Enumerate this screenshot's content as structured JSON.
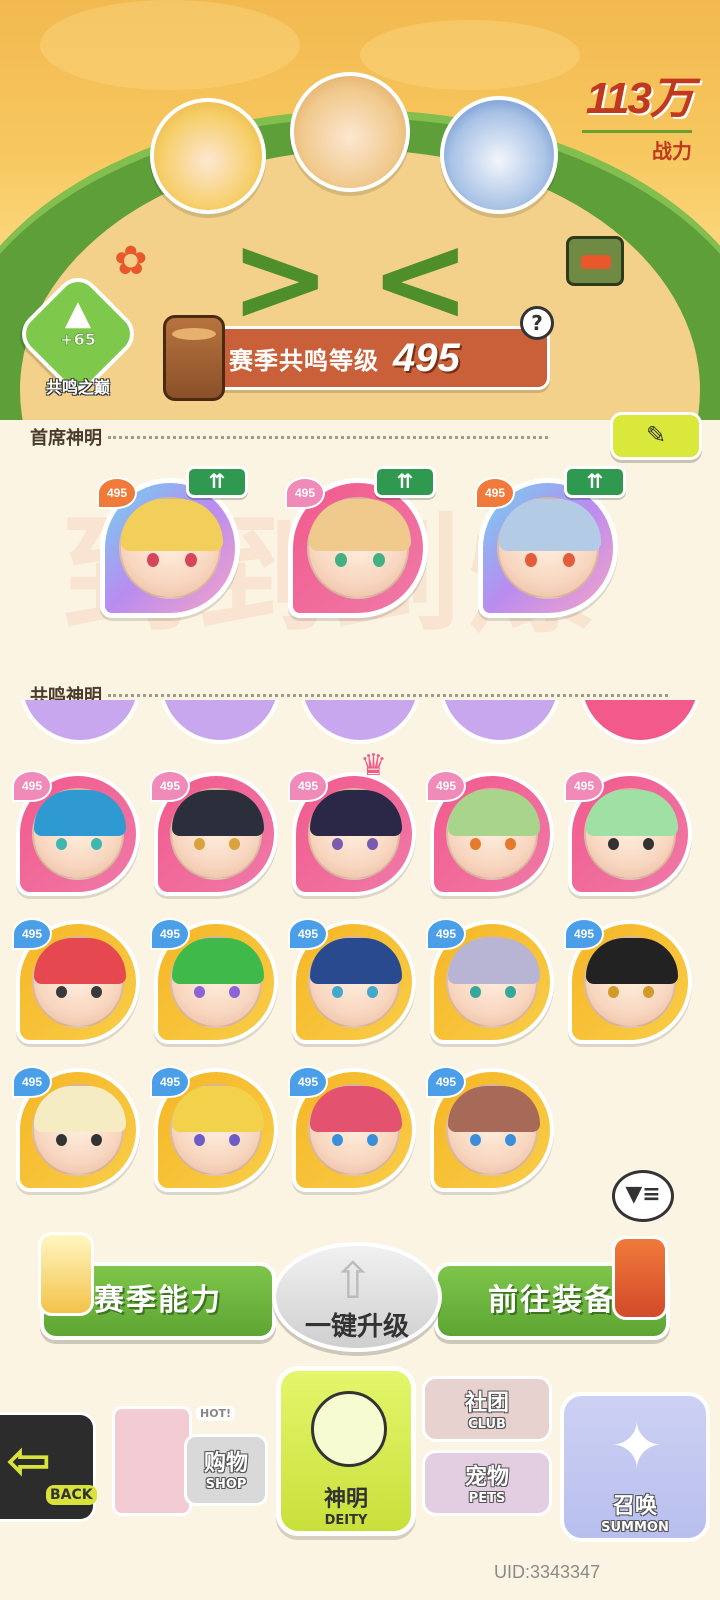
{
  "power": {
    "value": "113万",
    "label": "战力"
  },
  "peak": {
    "bonus": "+65",
    "label": "共鸣之巅"
  },
  "season": {
    "label": "赛季共鸣等级",
    "level": "495"
  },
  "sections": {
    "chief": "首席神明",
    "resonance": "共鸣神明"
  },
  "watermark": "到到到爆",
  "chief_heroes": [
    {
      "level": "495",
      "frame": "rainbow",
      "hair": "#f2cf5a",
      "eyes": "#d7455a"
    },
    {
      "level": "495",
      "frame": "pink",
      "hair": "#f0c98c",
      "eyes": "#43b084"
    },
    {
      "level": "495",
      "frame": "rainbow",
      "hair": "#b4cbe6",
      "eyes": "#e45d3a"
    }
  ],
  "up_tag": "⇈",
  "grid_rows": [
    [
      {
        "level": "495",
        "frame": "pink",
        "hair": "#2f9ad1",
        "eyes": "#3fb6b0"
      },
      {
        "level": "495",
        "frame": "pink",
        "hair": "#2b2f3b",
        "eyes": "#d9a23a"
      },
      {
        "level": "495",
        "frame": "pink",
        "hair": "#2a2846",
        "eyes": "#7b5bb0"
      },
      {
        "level": "495",
        "frame": "pink",
        "hair": "#a8d48c",
        "eyes": "#e47a2a"
      },
      {
        "level": "495",
        "frame": "pink",
        "hair": "#9fe0a4",
        "eyes": "#333333"
      }
    ],
    [
      {
        "level": "495",
        "frame": "gold",
        "hair": "#e5484f",
        "eyes": "#3a3a3a"
      },
      {
        "level": "495",
        "frame": "gold",
        "hair": "#3fb94a",
        "eyes": "#8c63d9"
      },
      {
        "level": "495",
        "frame": "gold",
        "hair": "#2a4a8f",
        "eyes": "#45a7c9"
      },
      {
        "level": "495",
        "frame": "gold",
        "hair": "#b7b5d3",
        "eyes": "#36a79d"
      },
      {
        "level": "495",
        "frame": "gold",
        "hair": "#222222",
        "eyes": "#d19a2a"
      }
    ],
    [
      {
        "level": "495",
        "frame": "gold",
        "hair": "#f6ecc4",
        "eyes": "#333333"
      },
      {
        "level": "495",
        "frame": "gold",
        "hair": "#f2d24a",
        "eyes": "#6d5bc9"
      },
      {
        "level": "495",
        "frame": "gold",
        "hair": "#e3526f",
        "eyes": "#3a8fd8"
      },
      {
        "level": "495",
        "frame": "gold",
        "hair": "#a86a58",
        "eyes": "#3a8fd8"
      }
    ]
  ],
  "actions": {
    "season_ability": "赛季能力",
    "one_click": "一键升级",
    "go_equip": "前往装备"
  },
  "nav": {
    "back": "BACK",
    "shop_cn": "购物",
    "shop_en": "SHOP",
    "shop_hot": "HOT!",
    "deity_cn": "神明",
    "deity_en": "DEITY",
    "club_cn": "社团",
    "club_en": "CLUB",
    "pets_cn": "宠物",
    "pets_en": "PETS",
    "summon_cn": "召唤",
    "summon_en": "SUMMON"
  },
  "uid": "UID:3343347",
  "icons": {
    "help": "question-icon",
    "edit": "pencil-icon",
    "filter": "filter-icon",
    "up": "double-up-arrow-icon",
    "back": "back-arrow-icon",
    "summon": "star-icon"
  }
}
